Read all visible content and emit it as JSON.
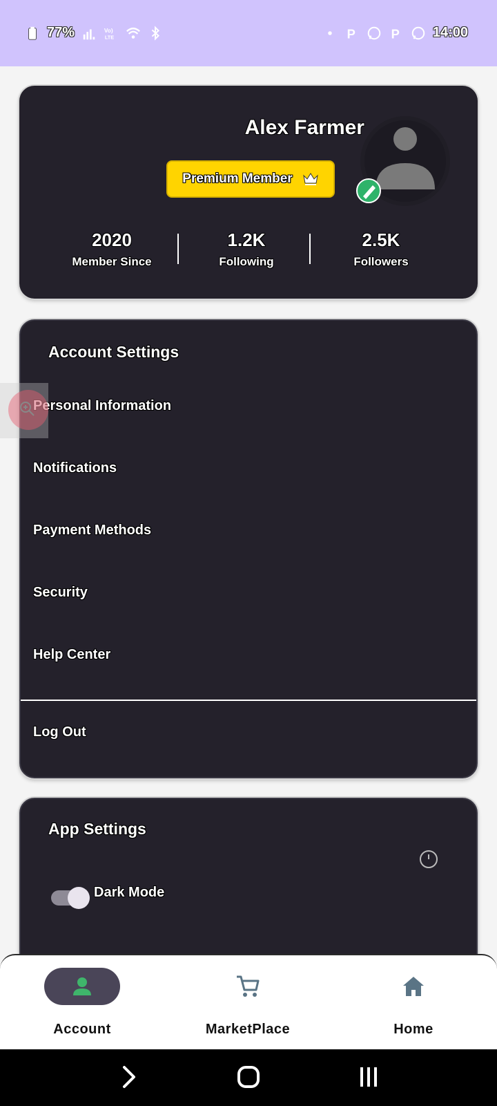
{
  "status_bar": {
    "battery": "77%",
    "time": "14:00",
    "icons": [
      "battery-icon",
      "signal-icon",
      "volte-icon",
      "wifi-icon",
      "bluetooth-icon",
      "dot-icon",
      "parking-icon",
      "whatsapp-icon",
      "parking-icon",
      "whatsapp-icon"
    ]
  },
  "profile": {
    "name": "Alex Farmer",
    "badge": "Premium Member",
    "stats": [
      {
        "value": "2020",
        "label": "Member Since"
      },
      {
        "value": "1.2K",
        "label": "Following"
      },
      {
        "value": "2.5K",
        "label": "Followers"
      }
    ]
  },
  "account_settings": {
    "title": "Account Settings",
    "items": [
      "Personal Information",
      "Notifications",
      "Payment Methods",
      "Security",
      "Help Center"
    ],
    "logout": "Log Out"
  },
  "app_settings": {
    "title": "App Settings",
    "dark_mode_label": "Dark Mode",
    "dark_mode_on": true
  },
  "bottom_nav": {
    "items": [
      {
        "label": "Account",
        "icon": "person-icon",
        "active": true
      },
      {
        "label": "MarketPlace",
        "icon": "cart-icon",
        "active": false
      },
      {
        "label": "Home",
        "icon": "home-icon",
        "active": false
      }
    ]
  },
  "colors": {
    "status_bar": "#d0c3fd",
    "card_bg": "#24212b",
    "premium": "#ffd400",
    "active_pill": "#4a4558",
    "active_icon": "#3fb56b",
    "inactive_icon": "#5a7485"
  }
}
